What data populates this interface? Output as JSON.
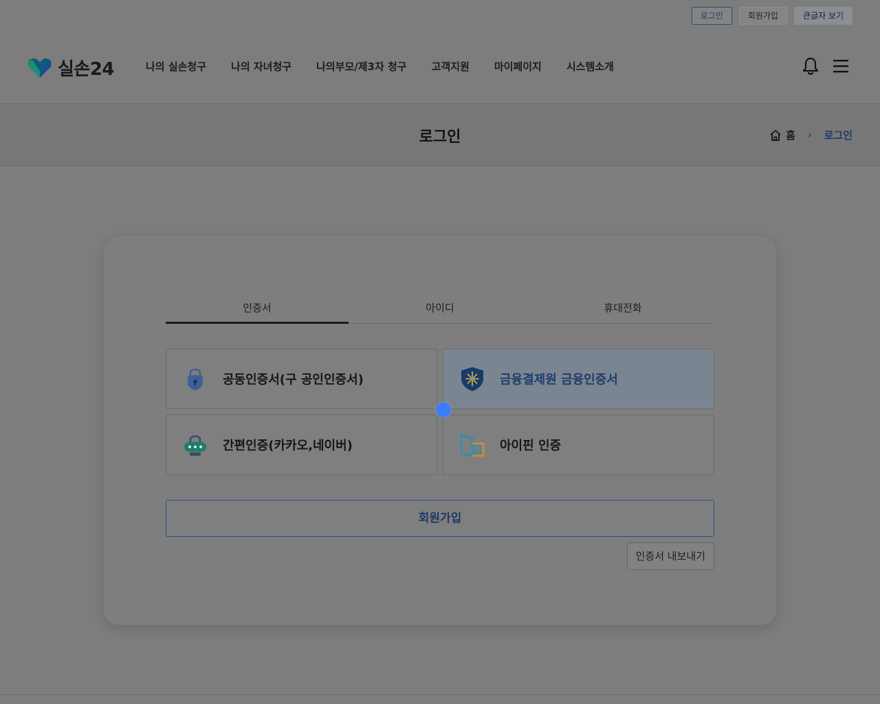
{
  "util": {
    "login": "로그인",
    "signup": "회원가입",
    "large_text": "큰글자 보기"
  },
  "header": {
    "logo_text": "실손24",
    "nav": [
      "나의 실손청구",
      "나의 자녀청구",
      "나의부모/제3자 청구",
      "고객지원",
      "마이페이지",
      "시스템소개"
    ],
    "icons": [
      "bell-icon",
      "hamburger-menu-icon"
    ]
  },
  "page": {
    "title": "로그인",
    "breadcrumb": {
      "home": "홈",
      "current": "로그인"
    }
  },
  "login": {
    "tabs": [
      {
        "label": "인증서",
        "active": true
      },
      {
        "label": "아이디",
        "active": false
      },
      {
        "label": "휴대전화",
        "active": false
      }
    ],
    "options": [
      {
        "label": "공동인증서(구 공인인증서)",
        "icon": "lock-shield-icon"
      },
      {
        "label": "금융결제원 금융인증서",
        "icon": "financial-cert-shield-icon"
      },
      {
        "label": "간편인증(카카오,네이버)",
        "icon": "password-lock-icon"
      },
      {
        "label": "아이핀 인증",
        "icon": "ipin-icon"
      }
    ],
    "signup_label": "회원가입",
    "export_label": "인증서 내보내기"
  },
  "colors": {
    "accent": "#1d3a6e",
    "highlight_bg": "#7b8592",
    "cursor": "#3d7bff"
  }
}
